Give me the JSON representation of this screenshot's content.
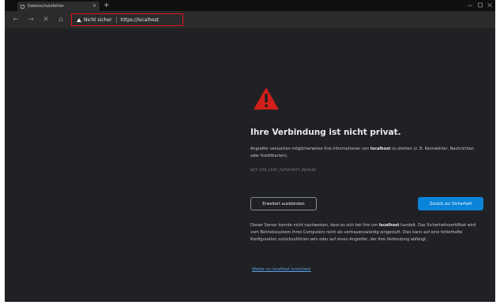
{
  "tab": {
    "title": "Datenschutzfehler",
    "close": "×",
    "new_tab": "+"
  },
  "toolbar": {
    "back": "←",
    "forward": "→",
    "reload": "✕",
    "home": "⌂",
    "security_label": "Nicht sicher",
    "url": "https://localhost"
  },
  "page": {
    "heading": "Ihre Verbindung ist nicht privat.",
    "intro_prefix": "Angreifer versuchen möglicherweise Ihre Informationen von ",
    "intro_host": "localhost",
    "intro_suffix": " zu stehlen (z. B. Kennwörter, Nachrichten oder Kreditkarten).",
    "error_code": "NET::ERR_CERT_AUTHORITY_INVALID",
    "details_button": "Erweitert ausblenden",
    "back_button": "Zurück zur Sicherheit",
    "details_prefix": "Dieser Server konnte nicht nachweisen, dass es sich bei ihm um ",
    "details_host": "localhost",
    "details_suffix": " handelt. Das Sicherheitszertifikat wird vom Betriebssystem Ihres Computers nicht als vertrauenswürdig eingestuft. Dies kann auf eine fehlerhafte Konfiguration zurückzuführen sein oder auf einen Angreifer, der Ihre Verbindung abfängt.",
    "proceed_link": "Weiter zu localhost (unsicher)"
  },
  "colors": {
    "background": "#202124",
    "warning_red": "#d21f1a",
    "highlight_box": "#e0141c",
    "primary_button": "#0a84d8",
    "link": "#5aa2e8"
  },
  "icons": {
    "warning": "warning-triangle-icon",
    "security": "not-secure-warning-icon"
  }
}
